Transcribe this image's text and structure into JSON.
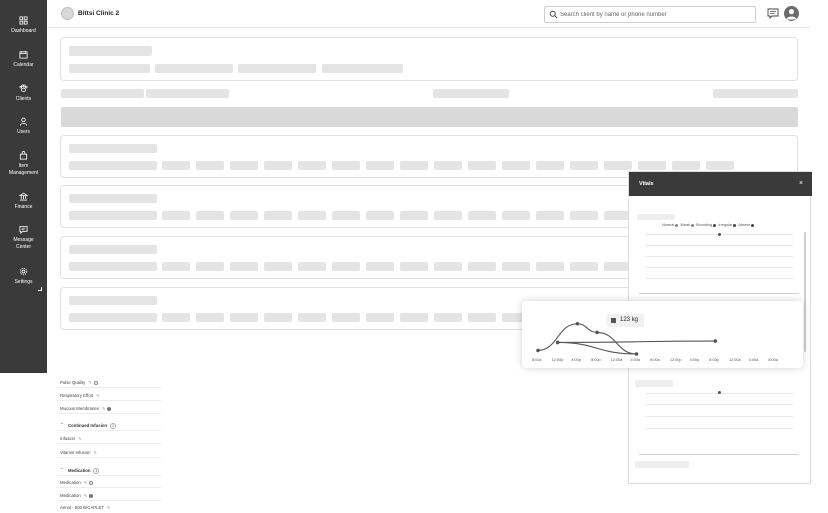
{
  "header": {
    "clinic_name": "Bittsi Clinic 2",
    "search_placeholder": "Search client by name or phone number"
  },
  "sidebar": {
    "items": [
      {
        "label": "Dashboard",
        "icon": "dashboard-icon"
      },
      {
        "label": "Calendar",
        "icon": "calendar-icon"
      },
      {
        "label": "Clients",
        "icon": "clients-icon"
      },
      {
        "label": "Users",
        "icon": "users-icon"
      },
      {
        "label_line1": "Item",
        "label_line2": "Management",
        "icon": "item-management-icon"
      },
      {
        "label": "Finance",
        "icon": "finance-icon"
      },
      {
        "label_line1": "Message",
        "label_line2": "Center",
        "icon": "message-center-icon"
      },
      {
        "label": "Settings",
        "icon": "settings-icon"
      }
    ]
  },
  "vitals": {
    "title": "Vitals",
    "close": "×",
    "legend": [
      "Normal",
      "Weak",
      "Bounding",
      "Irregular",
      "Absent"
    ]
  },
  "popup": {
    "tooltip_value": "123 kg",
    "x_ticks": [
      "8:00a",
      "12:00p",
      "4:00p",
      "8:00p",
      "12:00a",
      "4:00a",
      "8:00a",
      "12:00p",
      "4:00p",
      "8:00p",
      "12:00a",
      "4:00a",
      "8:00a"
    ]
  },
  "chart_data": {
    "type": "line",
    "title": "",
    "x": [
      "8:00a",
      "12:00p",
      "4:00p",
      "8:00p",
      "12:00a",
      "4:00a",
      "8:00a",
      "12:00p",
      "4:00p",
      "8:00p",
      "12:00a",
      "4:00a",
      "8:00a"
    ],
    "points": [
      {
        "x": "8:00a",
        "y": 0.1
      },
      {
        "x": "4:00p",
        "y": 0.84
      },
      {
        "x": "8:00p",
        "y": 0.6
      },
      {
        "x": "4:00a",
        "y": 0.0
      },
      {
        "x": "12:00p",
        "y": 0.32
      },
      {
        "x": "8:00p",
        "y": 0.36
      }
    ],
    "grid": false
  },
  "lower_list": [
    {
      "kind": "row",
      "label": "Pulse Quality"
    },
    {
      "kind": "row",
      "label": "Respiratory Effort"
    },
    {
      "kind": "row",
      "label": "Mucous Membranes"
    },
    {
      "kind": "group",
      "label": "Continued Infusion",
      "count": "2"
    },
    {
      "kind": "row",
      "label": "Infusion"
    },
    {
      "kind": "row",
      "label": "Vitamin Infusion"
    },
    {
      "kind": "group",
      "label": "Medication",
      "count": "4"
    },
    {
      "kind": "row",
      "label": "Medication"
    },
    {
      "kind": "row",
      "label": "Medication"
    },
    {
      "kind": "row",
      "label": "Aenol - 500 B/CAPLET"
    }
  ]
}
